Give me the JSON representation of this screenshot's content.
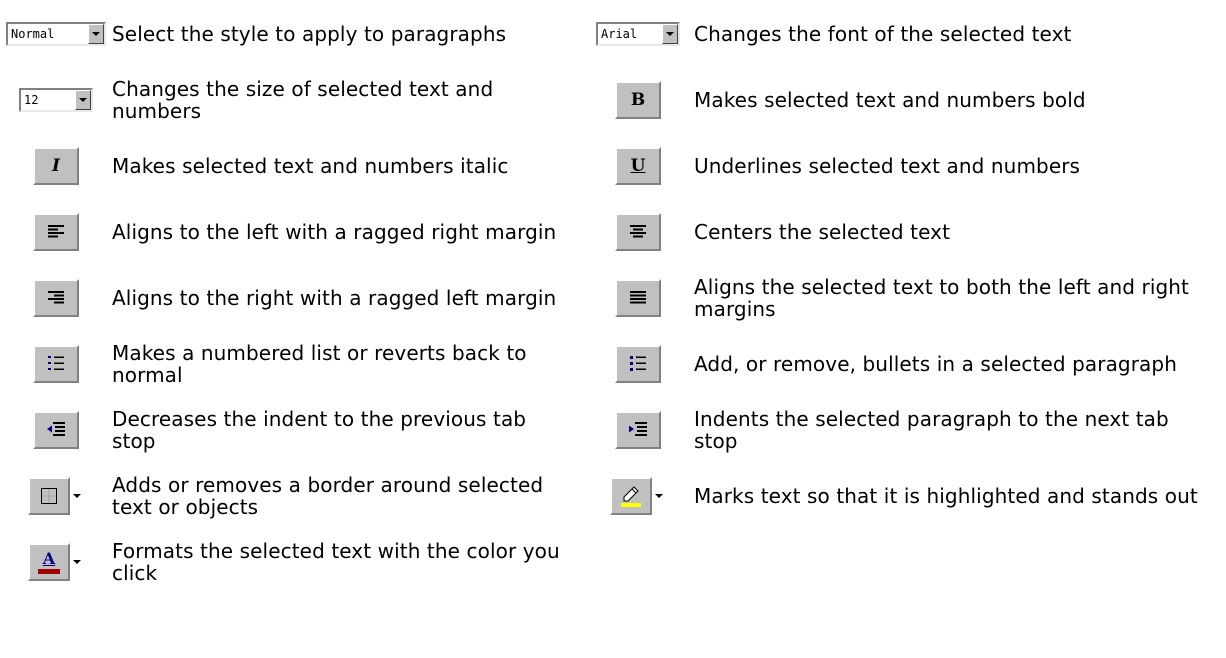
{
  "left": [
    {
      "icon": "style-combo-icon",
      "combo_text": "Normal",
      "text": "Select the style to apply to paragraphs"
    },
    {
      "icon": "font-size-combo-icon",
      "combo_text": "12",
      "text": "Changes the size of selected text and numbers"
    },
    {
      "icon": "italic-icon",
      "glyph": "I",
      "text": "Makes selected text and numbers italic"
    },
    {
      "icon": "align-left-icon",
      "text": "Aligns to the left with a ragged right margin"
    },
    {
      "icon": "align-right-icon",
      "text": "Aligns to the right with a ragged left margin"
    },
    {
      "icon": "numbered-list-icon",
      "text": "Makes a numbered list or reverts back to normal"
    },
    {
      "icon": "decrease-indent-icon",
      "text": "Decreases the indent to the previous tab stop"
    },
    {
      "icon": "border-icon",
      "text": "Adds or removes a border around selected text or objects"
    },
    {
      "icon": "font-color-icon",
      "glyph": "A",
      "text": "Formats the selected text with the color you click"
    }
  ],
  "right": [
    {
      "icon": "font-combo-icon",
      "combo_text": "Arial",
      "text": "Changes the font of the selected text"
    },
    {
      "icon": "bold-icon",
      "glyph": "B",
      "text": "Makes selected text and numbers bold"
    },
    {
      "icon": "underline-icon",
      "glyph": "U",
      "text": "Underlines selected text and numbers"
    },
    {
      "icon": "align-center-icon",
      "text": "Centers the selected text"
    },
    {
      "icon": "justify-icon",
      "text": "Aligns the selected text to both the left and right margins"
    },
    {
      "icon": "bullets-icon",
      "text": "Add, or remove, bullets in a selected paragraph"
    },
    {
      "icon": "increase-indent-icon",
      "text": "Indents the selected paragraph to the next tab stop"
    },
    {
      "icon": "highlight-icon",
      "text": "Marks text so that it is highlighted and stands out"
    }
  ],
  "colors": {
    "button_face": "#c0c0c0",
    "list_blue": "#000080",
    "highlight_yellow": "#ffff00",
    "font_color_red": "#a00000"
  }
}
